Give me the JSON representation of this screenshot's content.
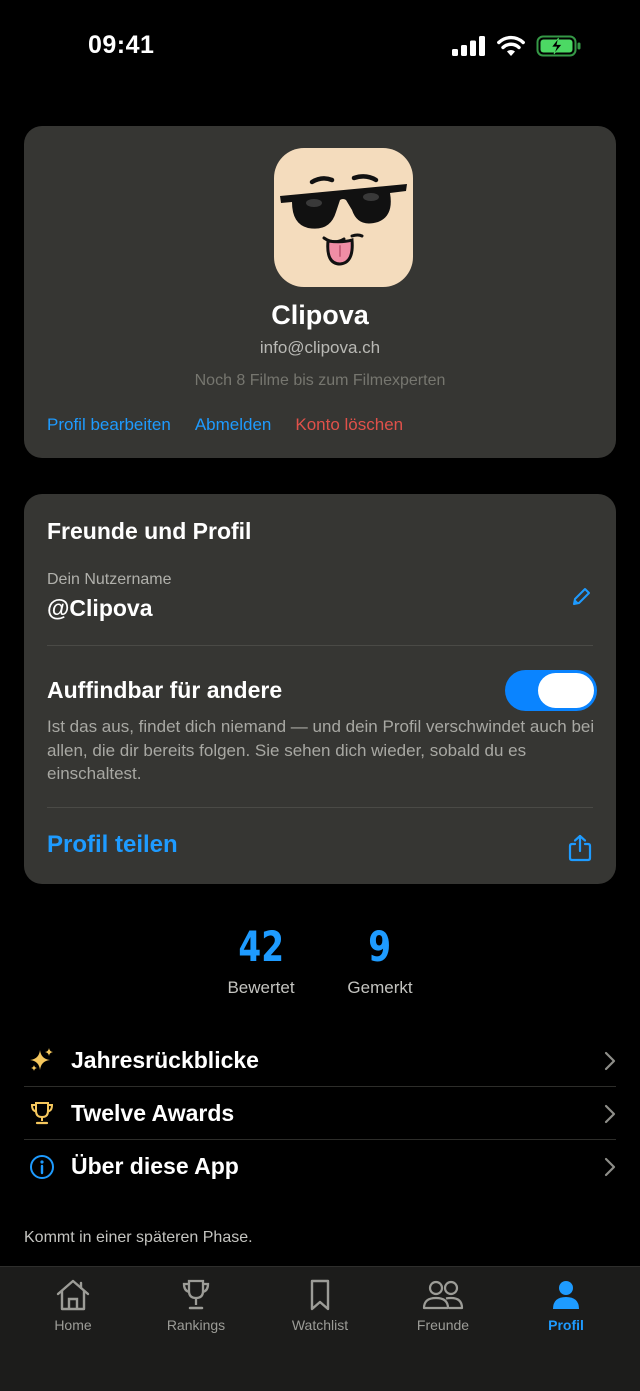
{
  "status_bar": {
    "time": "09:41",
    "icons": [
      "cellular-signal-icon",
      "wifi-icon",
      "battery-charging-icon"
    ]
  },
  "profile": {
    "avatar_icon": "sunglasses-face-icon",
    "name": "Clipova",
    "email": "info@clipova.ch",
    "progress_text": "Noch 8 Filme bis zum Filmexperten",
    "actions": {
      "edit": "Profil bearbeiten",
      "logout": "Abmelden",
      "delete": "Konto löschen"
    }
  },
  "friends": {
    "title": "Freunde und Profil",
    "username_label": "Dein Nutzername",
    "username_value": "@Clipova",
    "discoverable_label": "Auffindbar für andere",
    "discoverable_on": true,
    "discoverable_description": "Ist das aus, findet dich niemand — und dein Profil verschwindet auch bei allen, die dir bereits folgen. Sie sehen dich wieder, sobald du es einschaltest.",
    "share_label": "Profil teilen"
  },
  "stats": [
    {
      "value": "42",
      "label": "Bewertet"
    },
    {
      "value": "9",
      "label": "Gemerkt"
    }
  ],
  "menu": [
    {
      "icon": "sparkles-icon",
      "label": "Jahresrückblicke"
    },
    {
      "icon": "trophy-icon",
      "label": "Twelve Awards"
    },
    {
      "icon": "info-icon",
      "label": "Über diese App"
    }
  ],
  "footnote": "Kommt in einer späteren Phase.",
  "tabs": [
    {
      "icon": "home-icon",
      "label": "Home"
    },
    {
      "icon": "trophy-icon",
      "label": "Rankings"
    },
    {
      "icon": "bookmark-icon",
      "label": "Watchlist"
    },
    {
      "icon": "people-icon",
      "label": "Freunde"
    },
    {
      "icon": "person-icon",
      "label": "Profil",
      "active": true
    }
  ],
  "colors": {
    "accent": "#1e9bff",
    "danger": "#e0514a",
    "card": "#363633",
    "background": "#000000",
    "toggle_on": "#0a84ff",
    "battery": "#4cd964"
  }
}
